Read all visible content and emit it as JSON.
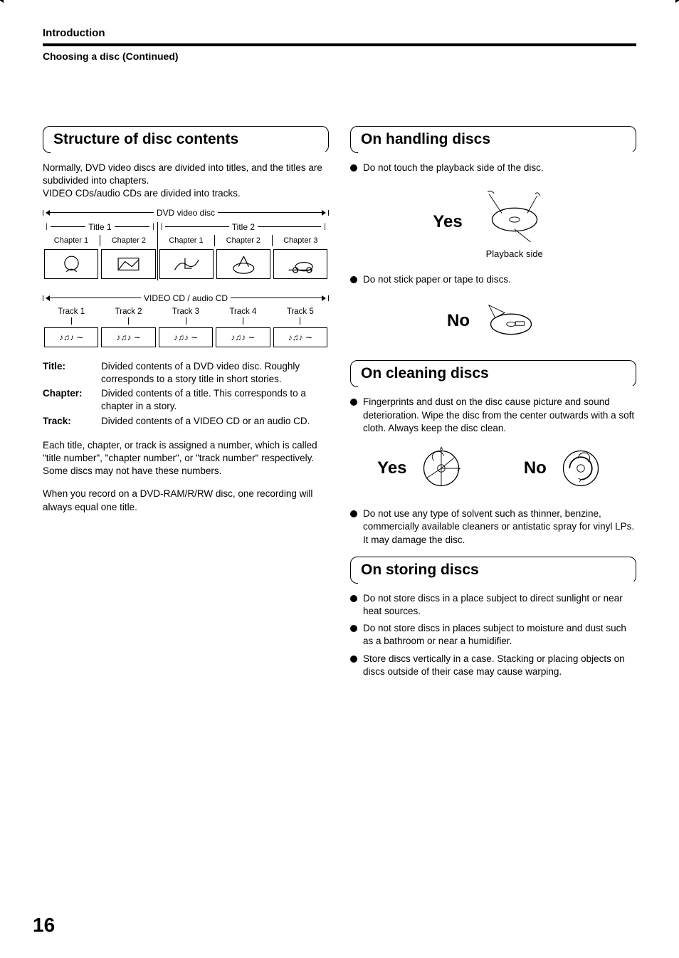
{
  "header": {
    "section": "Introduction",
    "subsection": "Choosing a disc (Continued)"
  },
  "left": {
    "h1": "Structure of disc contents",
    "p1": "Normally, DVD video discs are divided into titles, and the titles are subdivided into chapters.",
    "p2": "VIDEO CDs/audio CDs are divided into tracks.",
    "dvd": {
      "span": "DVD video disc",
      "title1": "Title 1",
      "title2": "Title 2",
      "t1chapters": [
        "Chapter 1",
        "Chapter 2"
      ],
      "t2chapters": [
        "Chapter 1",
        "Chapter 2",
        "Chapter 3"
      ]
    },
    "cd": {
      "span": "VIDEO CD / audio CD",
      "tracks": [
        "Track 1",
        "Track 2",
        "Track 3",
        "Track 4",
        "Track 5"
      ]
    },
    "defs": {
      "title_term": "Title:",
      "title_desc": "Divided contents of a DVD video disc. Roughly corresponds to a story title in short stories.",
      "chapter_term": "Chapter:",
      "chapter_desc": "Divided contents of a title. This corresponds to a chapter in a story.",
      "track_term": "Track:",
      "track_desc": "Divided contents of a VIDEO CD or an audio CD."
    },
    "p3": "Each title, chapter, or track is assigned a number, which is called \"title number\", \"chapter number\", or \"track number\" respectively.",
    "p4": "Some discs may not have these numbers.",
    "p5": "When you record on a DVD-RAM/R/RW disc, one recording will always equal one title."
  },
  "right": {
    "handling": {
      "h": "On handling discs",
      "b1": "Do not touch the playback side of the disc.",
      "yes": "Yes",
      "playback_side": "Playback side",
      "b2": "Do not stick paper or tape to discs.",
      "no": "No"
    },
    "cleaning": {
      "h": "On cleaning discs",
      "b1": "Fingerprints and dust on the disc cause picture and sound deterioration. Wipe the disc from the center outwards with a soft cloth. Always keep the disc clean.",
      "yes": "Yes",
      "no": "No",
      "b2": "Do not use any type of solvent such as thinner, benzine, commercially available cleaners or antistatic spray for vinyl LPs. It may damage the disc."
    },
    "storing": {
      "h": "On storing discs",
      "b1": "Do not store discs in a place subject to direct sunlight or near heat sources.",
      "b2": "Do not store discs in places subject to moisture and dust such as a bathroom or near a humidifier.",
      "b3": "Store discs vertically in a case. Stacking or placing objects on discs outside of their case may cause warping."
    }
  },
  "page_number": "16",
  "icons": {
    "music_notes": "♪♫♪ ∼"
  }
}
